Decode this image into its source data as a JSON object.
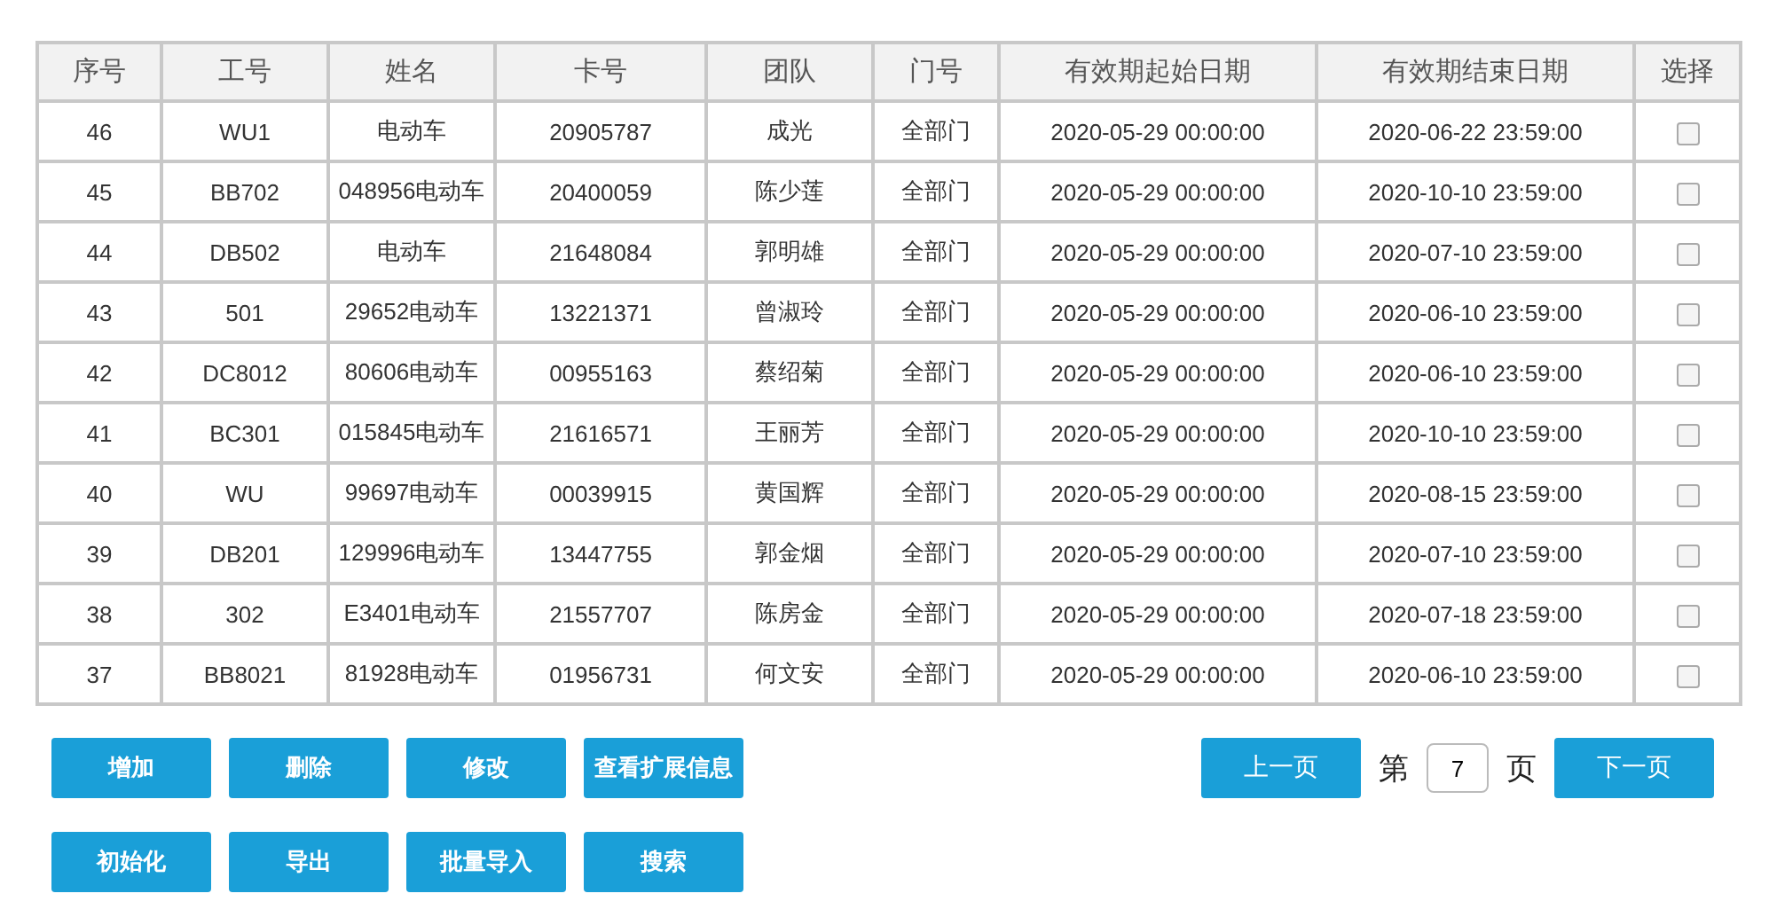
{
  "table": {
    "columns": [
      "序号",
      "工号",
      "姓名",
      "卡号",
      "团队",
      "门号",
      "有效期起始日期",
      "有效期结束日期",
      "选择"
    ],
    "rows": [
      {
        "cells": [
          "46",
          "WU1",
          "电动车",
          "20905787",
          "成光",
          "全部门",
          "2020-05-29 00:00:00",
          "2020-06-22 23:59:00"
        ],
        "checked": false
      },
      {
        "cells": [
          "45",
          "BB702",
          "048956电动车",
          "20400059",
          "陈少莲",
          "全部门",
          "2020-05-29 00:00:00",
          "2020-10-10 23:59:00"
        ],
        "checked": false
      },
      {
        "cells": [
          "44",
          "DB502",
          "电动车",
          "21648084",
          "郭明雄",
          "全部门",
          "2020-05-29 00:00:00",
          "2020-07-10 23:59:00"
        ],
        "checked": false
      },
      {
        "cells": [
          "43",
          "501",
          "29652电动车",
          "13221371",
          "曾淑玲",
          "全部门",
          "2020-05-29 00:00:00",
          "2020-06-10 23:59:00"
        ],
        "checked": false
      },
      {
        "cells": [
          "42",
          "DC8012",
          "80606电动车",
          "00955163",
          "蔡绍菊",
          "全部门",
          "2020-05-29 00:00:00",
          "2020-06-10 23:59:00"
        ],
        "checked": false
      },
      {
        "cells": [
          "41",
          "BC301",
          "015845电动车",
          "21616571",
          "王丽芳",
          "全部门",
          "2020-05-29 00:00:00",
          "2020-10-10 23:59:00"
        ],
        "checked": false
      },
      {
        "cells": [
          "40",
          "WU",
          "99697电动车",
          "00039915",
          "黄国辉",
          "全部门",
          "2020-05-29 00:00:00",
          "2020-08-15 23:59:00"
        ],
        "checked": false
      },
      {
        "cells": [
          "39",
          "DB201",
          "129996电动车",
          "13447755",
          "郭金烟",
          "全部门",
          "2020-05-29 00:00:00",
          "2020-07-10 23:59:00"
        ],
        "checked": false
      },
      {
        "cells": [
          "38",
          "302",
          "E3401电动车",
          "21557707",
          "陈房金",
          "全部门",
          "2020-05-29 00:00:00",
          "2020-07-18 23:59:00"
        ],
        "checked": false
      },
      {
        "cells": [
          "37",
          "BB8021",
          "81928电动车",
          "01956731",
          "何文安",
          "全部门",
          "2020-05-29 00:00:00",
          "2020-06-10 23:59:00"
        ],
        "checked": false
      }
    ]
  },
  "actions": [
    [
      "增加",
      "删除",
      "修改",
      "查看扩展信息"
    ],
    [
      "初始化",
      "导出",
      "批量导入",
      "搜索"
    ]
  ],
  "pager": {
    "prev": "上一页",
    "page_prefix": "第",
    "page": "7",
    "page_suffix": "页",
    "next": "下一页"
  }
}
